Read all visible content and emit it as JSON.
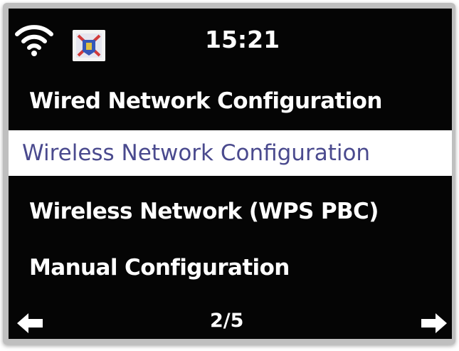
{
  "status_bar": {
    "time": "15:21",
    "wifi_icon": "wifi-icon",
    "station_logo_icon": "station-logo-icon"
  },
  "menu": {
    "items": [
      {
        "label": "Wired Network Configuration",
        "selected": false
      },
      {
        "label": "Wireless Network Configuration",
        "selected": true
      },
      {
        "label": "Wireless Network (WPS PBC)",
        "selected": false
      },
      {
        "label": "Manual Configuration",
        "selected": false
      }
    ]
  },
  "footer": {
    "page": "2/5",
    "left_icon": "arrow-left-icon",
    "right_icon": "arrow-right-icon"
  },
  "colors": {
    "background": "#050505",
    "text": "#ffffff",
    "selected_background": "#ffffff",
    "selected_text": "#4a4a8e"
  }
}
